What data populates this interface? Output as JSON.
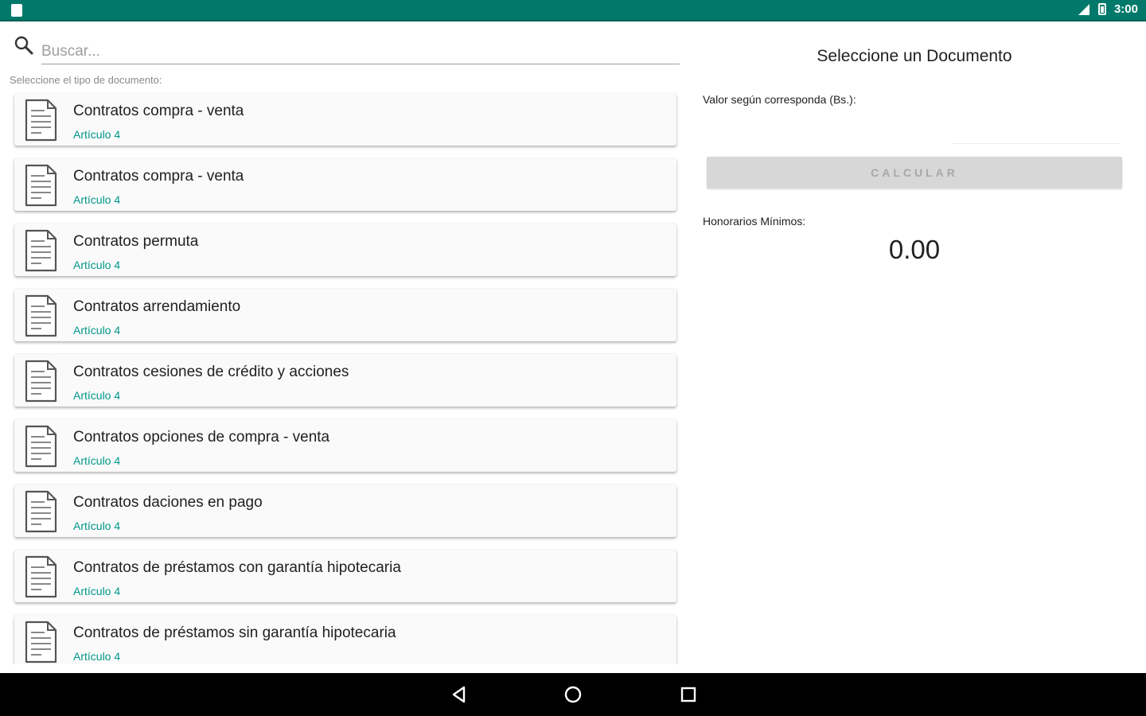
{
  "status_bar": {
    "time": "3:00"
  },
  "search": {
    "placeholder": "Buscar..."
  },
  "list": {
    "label": "Seleccione el tipo de documento:",
    "items": [
      {
        "title": "Contratos compra - venta",
        "subtitle": "Artículo 4"
      },
      {
        "title": "Contratos compra - venta",
        "subtitle": "Artículo 4"
      },
      {
        "title": "Contratos permuta",
        "subtitle": "Artículo 4"
      },
      {
        "title": "Contratos arrendamiento",
        "subtitle": "Artículo 4"
      },
      {
        "title": "Contratos cesiones de crédito y acciones",
        "subtitle": "Artículo 4"
      },
      {
        "title": "Contratos opciones de compra - venta",
        "subtitle": "Artículo 4"
      },
      {
        "title": "Contratos daciones en pago",
        "subtitle": "Artículo 4"
      },
      {
        "title": "Contratos de préstamos con garantía hipotecaria",
        "subtitle": "Artículo 4"
      },
      {
        "title": "Contratos de préstamos sin garantía hipotecaria",
        "subtitle": "Artículo 4"
      }
    ]
  },
  "detail": {
    "title": "Seleccione un Documento",
    "valor_label": "Valor según corresponda (Bs.):",
    "valor_value": "",
    "calc_button": "CALCULAR",
    "honorarios_label": "Honorarios Mínimos:",
    "honorarios_value": "0.00"
  },
  "colors": {
    "primary": "#00796b",
    "accent": "#009688"
  },
  "icons": {
    "search": "search-icon",
    "item": "document-icon",
    "back": "back-icon",
    "home": "home-icon",
    "recents": "recents-icon"
  }
}
